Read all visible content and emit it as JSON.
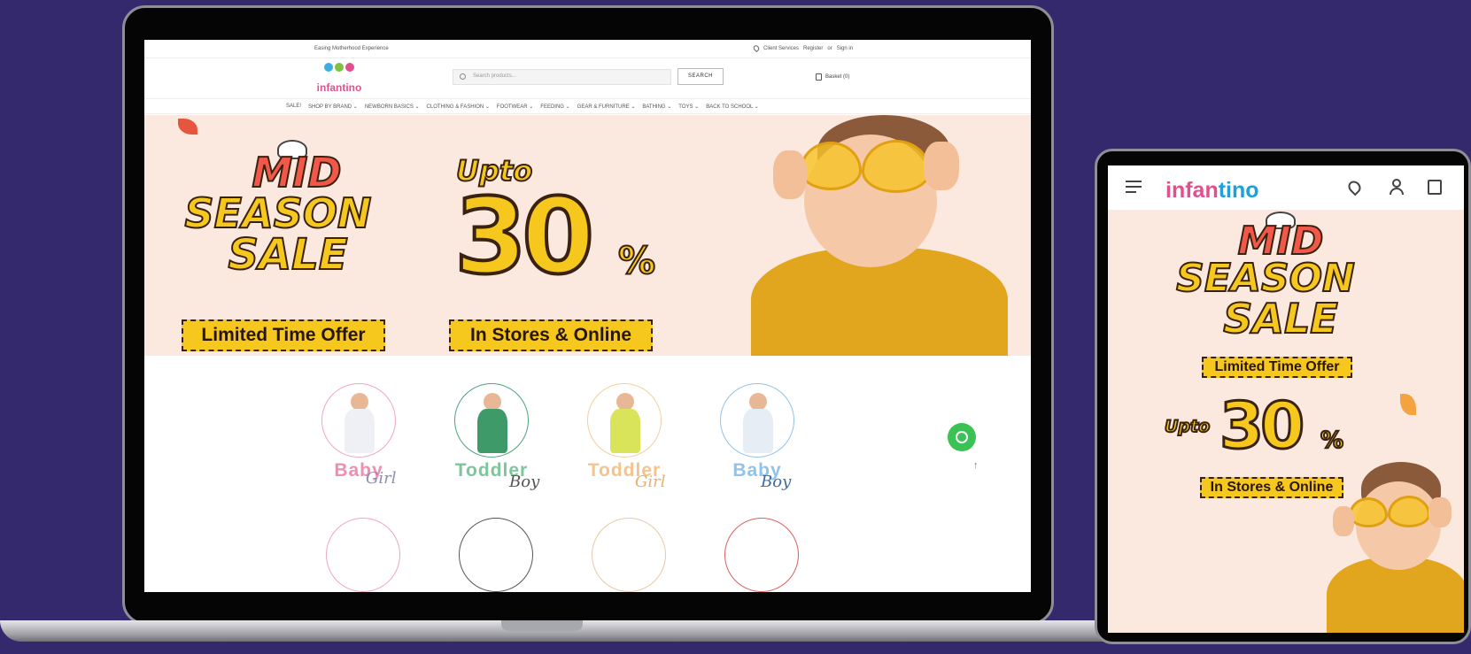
{
  "desktop": {
    "topbar": {
      "tagline": "Easing Motherhood Experience",
      "client_services": "Client Services",
      "register": "Register",
      "or": "or",
      "sign_in": "Sign in"
    },
    "header": {
      "logo_text": "infantino",
      "search_placeholder": "Search products...",
      "search_button": "SEARCH",
      "basket": "Basket (0)"
    },
    "nav": [
      "SALE!",
      "SHOP BY BRAND ⌄",
      "NEWBORN BASICS ⌄",
      "CLOTHING & FASHION ⌄",
      "FOOTWEAR ⌄",
      "FEEDING ⌄",
      "GEAR & FURNITURE ⌄",
      "BATHING ⌄",
      "TOYS ⌄",
      "BACK TO SCHOOL ⌄"
    ],
    "banner": {
      "line1": "MID",
      "line2": "SEASON",
      "line3": "SALE",
      "badge": "Limited Time Offer",
      "upto": "Upto",
      "discount": "30",
      "percent": "%",
      "channels": "In Stores & Online"
    },
    "categories": [
      {
        "word": "Baby",
        "script": "Girl",
        "color": "#f08db0",
        "outfit": "#eef0f6",
        "ring": "#f2a6b8"
      },
      {
        "word": "Toddler",
        "script": "Boy",
        "color": "#7cc79a",
        "outfit": "#3f9a6a",
        "ring": "#4aa57a"
      },
      {
        "word": "Toddler",
        "script": "Girl",
        "color": "#f5c38b",
        "outfit": "#d9e45a",
        "ring": "#f5cf9a"
      },
      {
        "word": "Baby",
        "script": "Boy",
        "color": "#8fc3ec",
        "outfit": "#e7edf5",
        "ring": "#8fc3ec"
      }
    ],
    "footwear_rings": [
      "#f2a6b8",
      "#555555",
      "#e7c9a4",
      "#e05c5c"
    ]
  },
  "tablet": {
    "logo_part1": "infan",
    "logo_part2": "tino",
    "banner": {
      "line1": "MID",
      "line2": "SEASON",
      "line3": "SALE",
      "badge": "Limited Time Offer",
      "upto": "Upto",
      "discount": "30",
      "percent": "%",
      "channels": "In Stores & Online"
    }
  },
  "colors": {
    "background": "#35296e",
    "brand_pink": "#e24f8f",
    "brand_blue": "#1fa0d8",
    "sale_yellow": "#f6c81d",
    "sale_red": "#f2584a",
    "whatsapp": "#3bc255"
  },
  "icons": [
    "search-icon",
    "location-pin-icon",
    "basket-icon",
    "whatsapp-icon",
    "scroll-up-icon",
    "menu-search-icon",
    "user-icon",
    "bag-icon"
  ]
}
